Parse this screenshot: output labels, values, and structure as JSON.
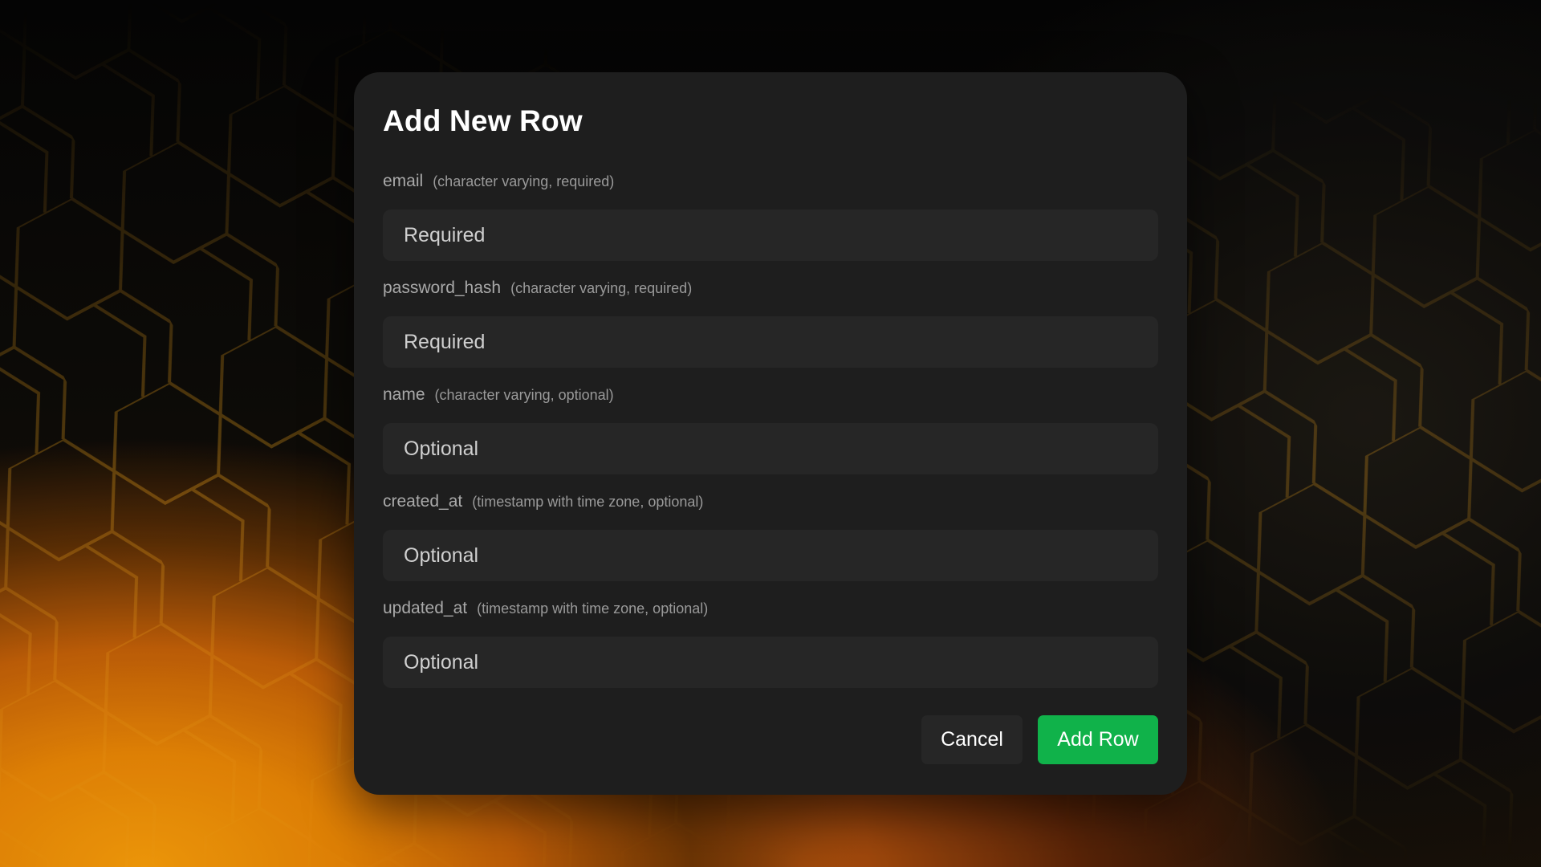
{
  "dialog": {
    "title": "Add New Row",
    "fields": [
      {
        "name": "email",
        "meta": "(character varying, required)",
        "placeholder": "Required",
        "value": ""
      },
      {
        "name": "password_hash",
        "meta": "(character varying, required)",
        "placeholder": "Required",
        "value": ""
      },
      {
        "name": "name",
        "meta": "(character varying, optional)",
        "placeholder": "Optional",
        "value": ""
      },
      {
        "name": "created_at",
        "meta": "(timestamp with time zone, optional)",
        "placeholder": "Optional",
        "value": ""
      },
      {
        "name": "updated_at",
        "meta": "(timestamp with time zone, optional)",
        "placeholder": "Optional",
        "value": ""
      }
    ],
    "cancel_label": "Cancel",
    "submit_label": "Add Row"
  },
  "colors": {
    "dialog_bg": "#1e1e1e",
    "input_bg": "#262626",
    "accent_green": "#10b24a",
    "backdrop_orange": "#f08a06"
  }
}
